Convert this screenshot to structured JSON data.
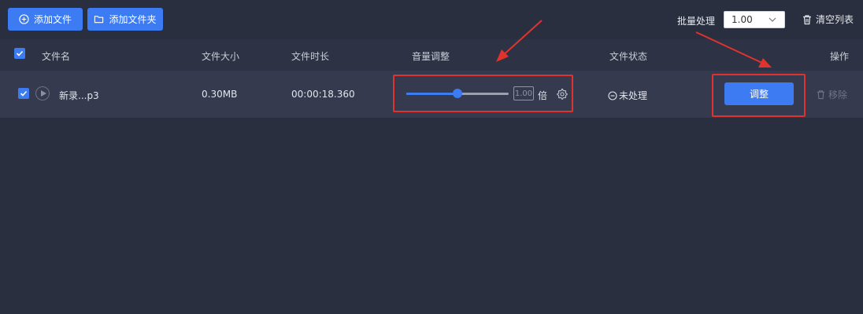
{
  "toolbar": {
    "add_file_label": "添加文件",
    "add_folder_label": "添加文件夹",
    "batch_label": "批量处理",
    "batch_value": "1.00",
    "clear_label": "清空列表"
  },
  "table": {
    "headers": {
      "filename": "文件名",
      "size": "文件大小",
      "duration": "文件时长",
      "volume": "音量调整",
      "status": "文件状态",
      "action": "操作"
    },
    "rows": [
      {
        "checked": true,
        "filename": "新录...p3",
        "size": "0.30MB",
        "duration": "00:00:18.360",
        "volume_fraction": 0.5,
        "volume_value": "1.00",
        "volume_unit": "倍",
        "status": "未处理",
        "adjust_label": "调整",
        "remove_label": "移除"
      }
    ]
  },
  "colors": {
    "accent": "#3d7bf2",
    "background": "#2a2f40",
    "highlight": "#e0332d"
  },
  "icons": [
    "add-circle-icon",
    "folder-icon",
    "chevron-down-icon",
    "trash-icon",
    "check-icon",
    "play-icon",
    "gear-icon",
    "minus-circle-icon"
  ]
}
